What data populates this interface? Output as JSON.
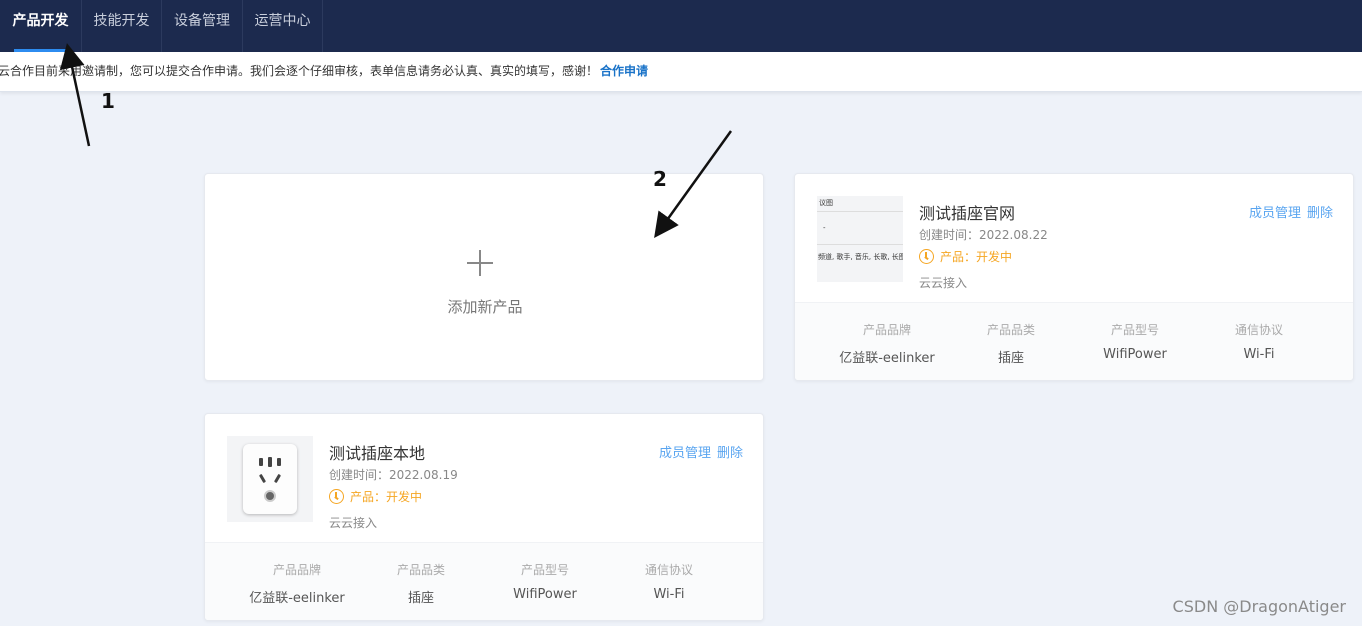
{
  "nav": {
    "tabs": [
      {
        "label": "产品开发",
        "active": true
      },
      {
        "label": "技能开发",
        "active": false
      },
      {
        "label": "设备管理",
        "active": false
      },
      {
        "label": "运营中心",
        "active": false
      }
    ]
  },
  "notice": {
    "text": "云合作目前采用邀请制，您可以提交合作申请。我们会逐个仔细审核，表单信息请务必认真、真实的填写，感谢！",
    "link_label": "合作申请"
  },
  "annotations": {
    "one": "1",
    "two": "2"
  },
  "add_product": {
    "label": "添加新产品"
  },
  "products": [
    {
      "name": "测试插座官网",
      "created": "创建时间：2022.08.22",
      "status": "产品：开发中",
      "access": "云云接入",
      "actions": {
        "members": "成员管理",
        "delete": "删除"
      },
      "thumb_text": {
        "top": "议图",
        "bottom": "频道, 歌手, 音乐, 长歌, 长图"
      },
      "specs": [
        {
          "key": "产品品牌",
          "value": "亿益联-eelinker"
        },
        {
          "key": "产品品类",
          "value": "插座"
        },
        {
          "key": "产品型号",
          "value": "WifiPower"
        },
        {
          "key": "通信协议",
          "value": "Wi-Fi"
        }
      ]
    },
    {
      "name": "测试插座本地",
      "created": "创建时间：2022.08.19",
      "status": "产品：开发中",
      "access": "云云接入",
      "actions": {
        "members": "成员管理",
        "delete": "删除"
      },
      "specs": [
        {
          "key": "产品品牌",
          "value": "亿益联-eelinker"
        },
        {
          "key": "产品品类",
          "value": "插座"
        },
        {
          "key": "产品型号",
          "value": "WifiPower"
        },
        {
          "key": "通信协议",
          "value": "Wi-Fi"
        }
      ]
    }
  ],
  "watermark": "CSDN @DragonAtiger",
  "colors": {
    "nav_bg": "#1c2a4e",
    "accent": "#2d8cf0",
    "status": "#f5a623",
    "link": "#5aa5f0"
  }
}
